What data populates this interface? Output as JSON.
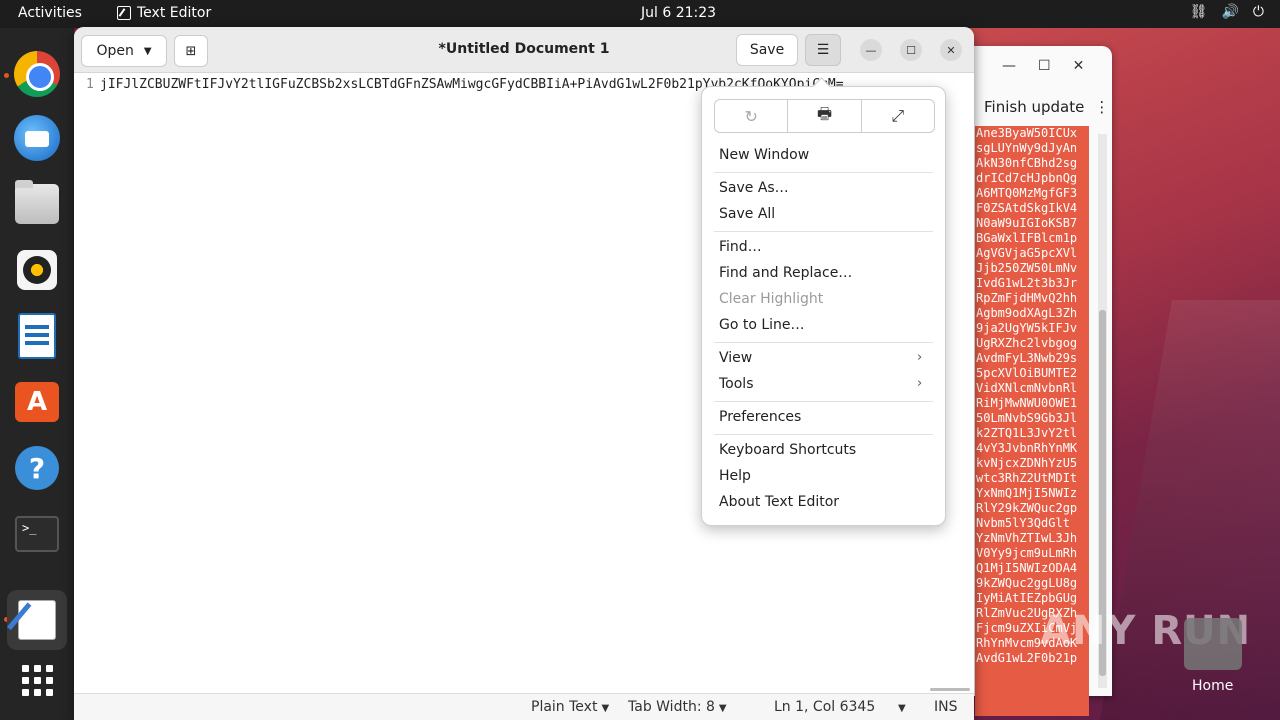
{
  "topbar": {
    "activities": "Activities",
    "app_name": "Text Editor",
    "clock": "Jul 6  21:23",
    "tray": {
      "network_icon": "network-icon",
      "volume_icon": "volume-icon",
      "power_icon": "power-icon"
    }
  },
  "dock": {
    "items": [
      "chrome",
      "thunderbird",
      "files",
      "rhythmbox",
      "libreoffice-writer",
      "app-center",
      "help",
      "terminal",
      "text-editor",
      "show-apps"
    ]
  },
  "background_window": {
    "finish_update": "Finish update",
    "code_lines": [
      "Ane3ByaW50ICUx",
      "sgLUYnWy9dJyAn",
      "AkN30nfCBhd2sg",
      "drICd7cHJpbnQg",
      "A6MTQ0MzMgfGF3",
      "F0ZSAtdSkgIkV4",
      "N0aW9uIGIoKSB7",
      "BGaWxlIFBlcm1p",
      "AgVGVjaG5pcXVl",
      "Jjb250ZW50LmNv",
      "IvdG1wL2t3b3Jr",
      "RpZmFjdHMvQ2hh",
      "Agbm9odXAgL3Zh",
      "9ja2UgYW5kIFJv",
      "UgRXZhc2lvbgog",
      "AvdmFyL3Nwb29s",
      "5pcXVlOiBUMTE2",
      "VidXNlcmNvbnRl",
      "RiMjMwNWU0OWE1",
      "50LmNvbS9Gb3Jl",
      "k2ZTQ1L3JvY2tl",
      "4vY3JvbnRhYnMK",
      "kvNjcxZDNhYzU5",
      "wtc3RhZ2UtMDIt",
      "YxNmQ1MjI5NWIz",
      "RlY29kZWQuc2gp",
      "Nvbm5lY3QdGlt",
      "YzNmVhZTIwL3Jh",
      "V0Yy9jcm9uLmRh",
      "Q1MjI5NWIzODA4",
      "9kZWQuc2ggLU8g",
      "IyMiAtIEZpbGUg",
      "RlZmVuc2UgRXZh",
      "Fjcm9uZXIiCmVj",
      "RhYnMvcm9vdAoK",
      "AvdG1wL2F0b21p"
    ]
  },
  "editor": {
    "open_label": "Open",
    "title": "*Untitled Document 1",
    "save_label": "Save",
    "line_number": "1",
    "line_text": "jIFJlZCBUZWFtIFJvY2tlIGFuZCBSb2xsLCBTdGFnZSAwMiwgcGFydCBBIiA+PiAvdG1wL2F0b21pYyb2cKfQoKYOpiCmM=",
    "status": {
      "language": "Plain Text",
      "tab_width": "Tab Width: 8",
      "position": "Ln 1, Col 6345",
      "mode": "INS"
    }
  },
  "menu": {
    "top_buttons": [
      "reload-icon",
      "print-icon",
      "fullscreen-icon"
    ],
    "new_window": "New Window",
    "save_as": "Save As…",
    "save_all": "Save All",
    "find": "Find…",
    "find_replace": "Find and Replace…",
    "clear_highlight": "Clear Highlight",
    "go_to_line": "Go to Line…",
    "view": "View",
    "tools": "Tools",
    "preferences": "Preferences",
    "keyboard_shortcuts": "Keyboard Shortcuts",
    "help": "Help",
    "about": "About Text Editor"
  },
  "desktop": {
    "watermark": "ANY RUN",
    "home_label": "Home"
  },
  "colors": {
    "accent": "#e95420",
    "code_bg": "#e55b44"
  }
}
